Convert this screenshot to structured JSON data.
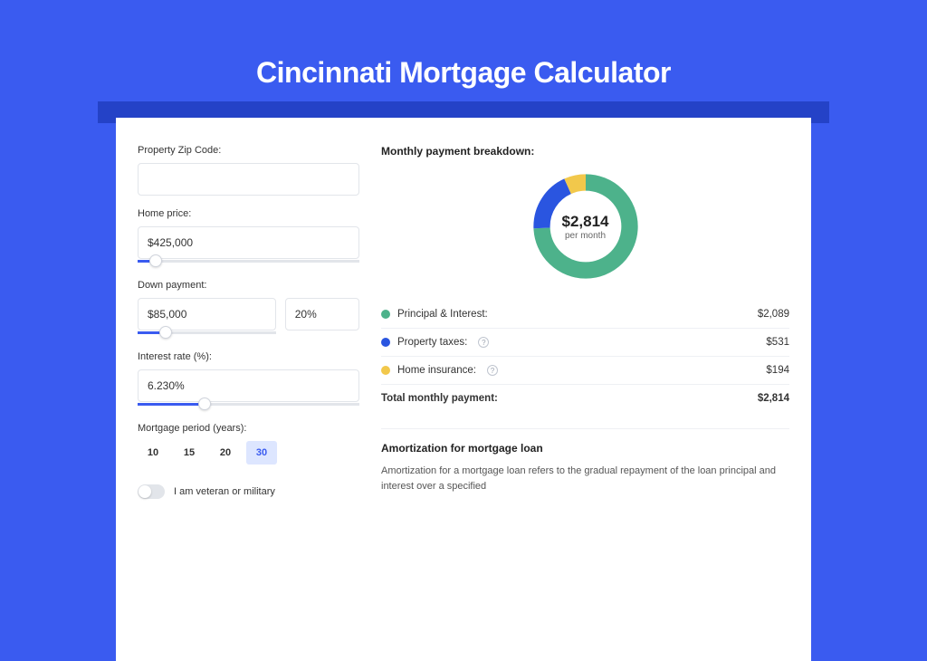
{
  "title": "Cincinnati Mortgage Calculator",
  "colors": {
    "green": "#4DB28B",
    "blue": "#2A55E0",
    "yellow": "#F2C84B"
  },
  "form": {
    "zip_label": "Property Zip Code:",
    "zip_value": "",
    "home_price_label": "Home price:",
    "home_price_value": "$425,000",
    "home_price_slider_pct": 8,
    "down_payment_label": "Down payment:",
    "down_payment_value": "$85,000",
    "down_payment_pct": "20%",
    "down_payment_slider_pct": 20,
    "rate_label": "Interest rate (%):",
    "rate_value": "6.230%",
    "rate_slider_pct": 30,
    "period_label": "Mortgage period (years):",
    "periods": [
      "10",
      "15",
      "20",
      "30"
    ],
    "period_selected": "30",
    "veteran_label": "I am veteran or military",
    "veteran_on": false
  },
  "breakdown": {
    "title": "Monthly payment breakdown:",
    "total": "$2,814",
    "per_month": "per month",
    "items": [
      {
        "label": "Principal & Interest:",
        "value": "$2,089",
        "color": "green",
        "num": 2089,
        "info": false
      },
      {
        "label": "Property taxes:",
        "value": "$531",
        "color": "blue",
        "num": 531,
        "info": true
      },
      {
        "label": "Home insurance:",
        "value": "$194",
        "color": "yellow",
        "num": 194,
        "info": true
      }
    ],
    "total_label": "Total monthly payment:",
    "total_value": "$2,814"
  },
  "amortization": {
    "title": "Amortization for mortgage loan",
    "text": "Amortization for a mortgage loan refers to the gradual repayment of the loan principal and interest over a specified"
  },
  "chart_data": {
    "type": "pie",
    "title": "Monthly payment breakdown",
    "total": 2814,
    "series": [
      {
        "name": "Principal & Interest",
        "value": 2089
      },
      {
        "name": "Property taxes",
        "value": 531
      },
      {
        "name": "Home insurance",
        "value": 194
      }
    ]
  }
}
